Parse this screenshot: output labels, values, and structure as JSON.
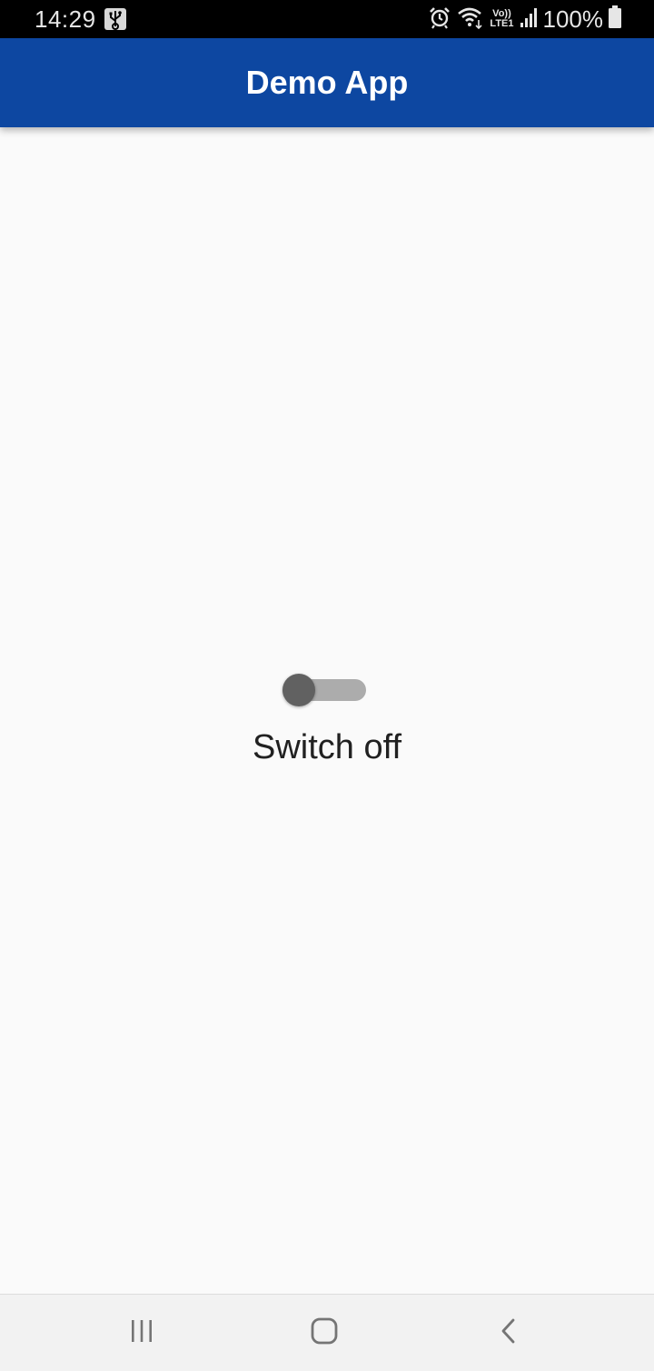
{
  "status_bar": {
    "time": "14:29",
    "battery_text": "100%",
    "icons": [
      "usb-icon",
      "alarm-icon",
      "wifi-icon",
      "volte-lte-icon",
      "signal-icon",
      "battery-icon"
    ],
    "volte_text": "Vo))",
    "lte_text": "LTE1"
  },
  "app_bar": {
    "title": "Demo App",
    "color": "#0d47a1"
  },
  "main": {
    "switch": {
      "state": "off",
      "thumb_color": "#616161",
      "track_color": "#acacac"
    },
    "switch_label": "Switch off"
  },
  "nav_bar": {
    "buttons": [
      "recents-icon",
      "home-icon",
      "back-icon"
    ]
  }
}
